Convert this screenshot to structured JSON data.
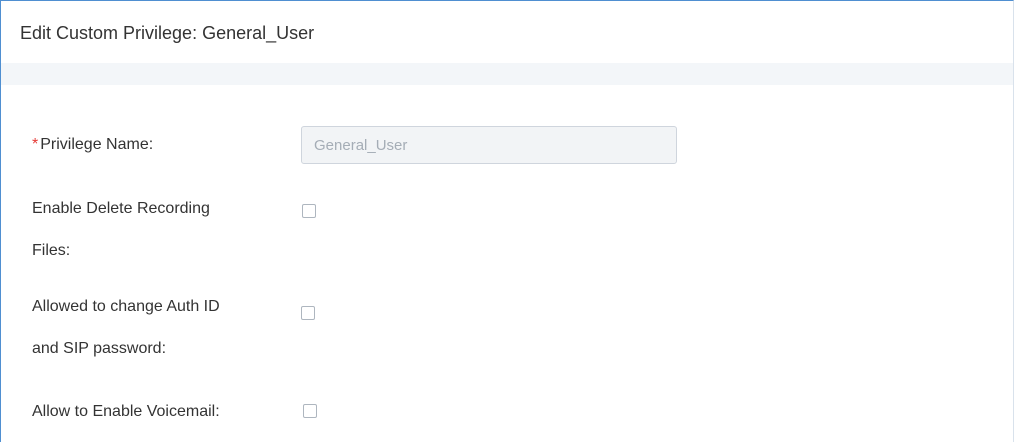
{
  "dialog": {
    "title": "Edit Custom Privilege: General_User"
  },
  "form": {
    "privilege_name": {
      "required_mark": "*",
      "label": "Privilege Name:",
      "value": "General_User"
    },
    "enable_delete_recording": {
      "label_line1": "Enable Delete Recording",
      "label_line2": "Files:",
      "checked": false
    },
    "allow_change_auth": {
      "label_line1": "Allowed to change Auth ID",
      "label_line2": "and SIP password:",
      "checked": false
    },
    "allow_enable_voicemail": {
      "label": "Allow to Enable Voicemail:",
      "checked": false
    }
  }
}
